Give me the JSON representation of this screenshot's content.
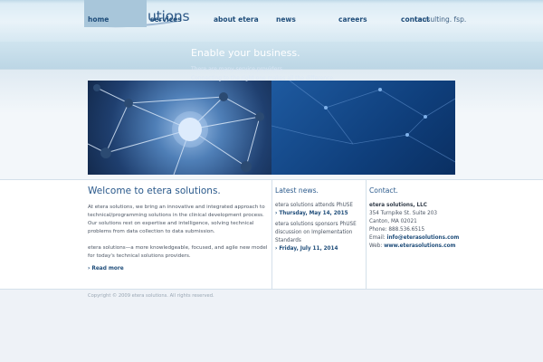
{
  "brand": {
    "logo_text": "etera solutions",
    "tagline": "consulting. fsp."
  },
  "nav": {
    "items": [
      {
        "label": "home",
        "active": true
      },
      {
        "label": "services"
      },
      {
        "label": "about etera"
      },
      {
        "label": "news"
      },
      {
        "label": "careers"
      },
      {
        "label": "contact"
      }
    ]
  },
  "hero": {
    "title": "Enable your business.",
    "line1": "There are many service providers.",
    "line2": "Connecting to the right one makes all the difference."
  },
  "welcome": {
    "title": "Welcome to etera solutions.",
    "paragraph1": "At etera solutions, we bring an innovative and integrated approach to technical/programming solutions in the clinical development process. Our solutions rest on expertise and intelligence, solving technical problems from data collection to data submission.",
    "paragraph2": "etera solutions—a more knowledgeable, focused, and agile new model for today's technical solutions providers.",
    "read_more": "› Read more"
  },
  "news": {
    "title": "Latest news.",
    "items": [
      {
        "text": "etera solutions attends PhUSE",
        "date": "› Thursday, May 14, 2015"
      },
      {
        "text": "etera solutions sponsors PhUSE discussion on Implementation Standards",
        "date": "› Friday, July 11, 2014"
      }
    ]
  },
  "contact": {
    "title": "Contact.",
    "company": "etera solutions, LLC",
    "street": "354 Turnpike St. Suite 203",
    "city": "Canton, MA 02021",
    "phone": "Phone: 888.536.6515",
    "email_label": "Email: ",
    "email": "info@eterasolutions.com",
    "web_label": "Web: ",
    "web": "www.eterasolutions.com"
  },
  "footer": {
    "copyright": "Copyright © 2009 etera solutions. All rights reserved."
  },
  "colors": {
    "accent": "#2b5a8c",
    "nav_active": "#a8c6da",
    "hero_blue": "#0f3f7c"
  }
}
